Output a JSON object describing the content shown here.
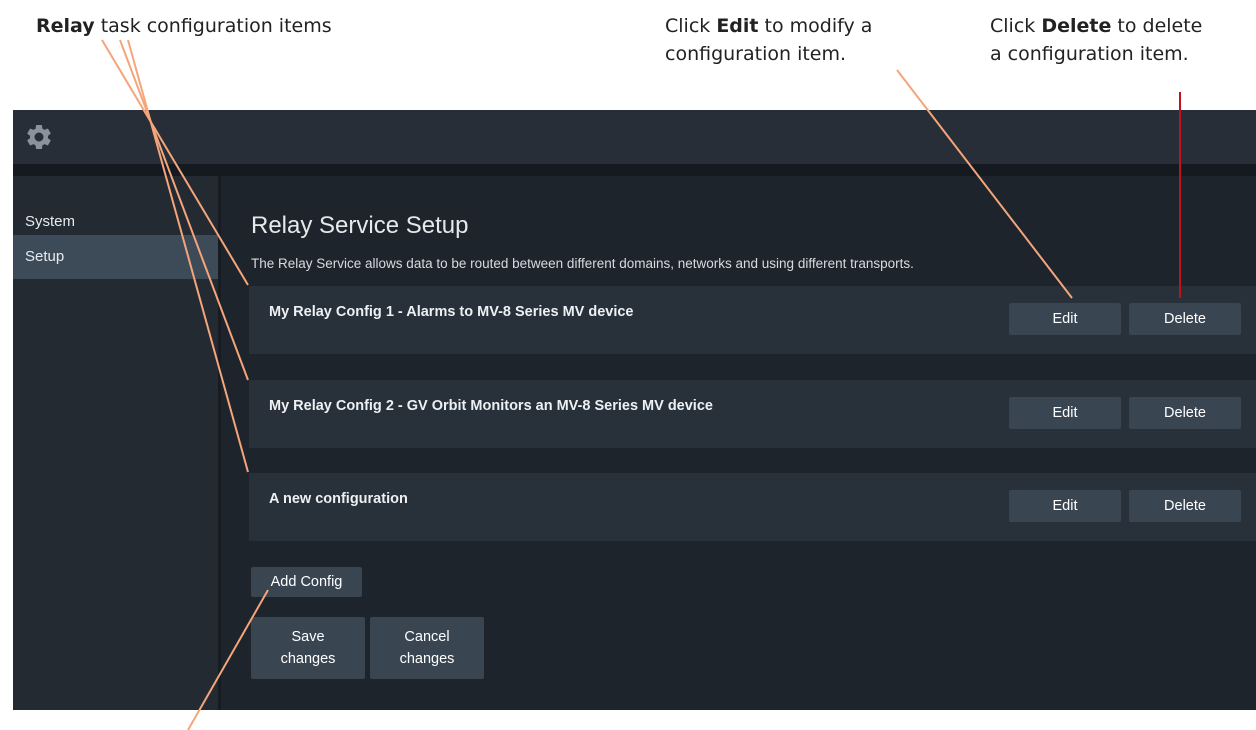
{
  "callouts": {
    "relay_bold": "Relay",
    "relay_rest": " task configuration items",
    "edit_pre": "Click ",
    "edit_bold": "Edit",
    "edit_post": " to modify a",
    "edit_line2": "configuration item.",
    "delete_pre": "Click ",
    "delete_bold": "Delete",
    "delete_post": " to delete",
    "delete_line2": "a configuration item."
  },
  "topbar": {
    "icon": "gear-icon"
  },
  "sidebar": {
    "items": [
      {
        "label": "System",
        "active": false
      },
      {
        "label": "Setup",
        "active": true
      }
    ]
  },
  "main": {
    "title": "Relay Service Setup",
    "description": "The Relay Service allows data to be routed between different domains, networks and using different transports.",
    "configs": [
      {
        "name": "My Relay Config 1 - Alarms to MV-8 Series MV device",
        "edit_label": "Edit",
        "delete_label": "Delete"
      },
      {
        "name": "My Relay Config 2 - GV Orbit Monitors an MV-8 Series MV device",
        "edit_label": "Edit",
        "delete_label": "Delete"
      },
      {
        "name": "A new configuration",
        "edit_label": "Edit",
        "delete_label": "Delete"
      }
    ],
    "add_label": "Add Config",
    "save_line1": "Save",
    "save_line2": "changes",
    "cancel_line1": "Cancel",
    "cancel_line2": "changes"
  },
  "colors": {
    "annotation_orange": "#f4a57a",
    "annotation_red": "#c0111f",
    "app_background": "#1d242c",
    "button": "#3a4552"
  }
}
